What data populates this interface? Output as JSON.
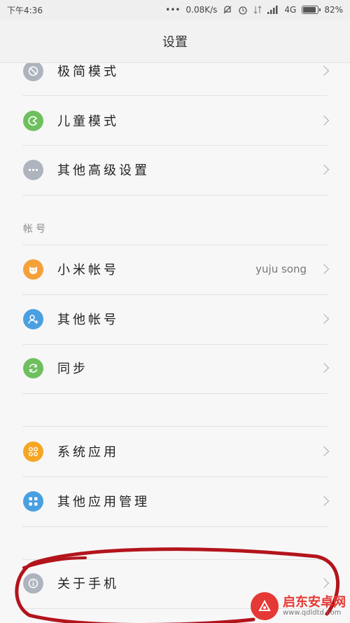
{
  "status": {
    "time": "下午4:36",
    "dots": "•••",
    "speed": "0.08K/s",
    "network": "4G",
    "battery": "82%"
  },
  "header": {
    "title": "设置"
  },
  "rows": {
    "minimal_mode": "极简模式",
    "kids_mode": "儿童模式",
    "advanced": "其他高级设置",
    "mi_account": "小米帐号",
    "mi_account_value": "yuju song",
    "other_accounts": "其他帐号",
    "sync": "同步",
    "system_apps": "系统应用",
    "other_app_mgmt": "其他应用管理",
    "about_phone": "关于手机"
  },
  "sections": {
    "account": "帐号"
  },
  "watermark": {
    "title": "启东安卓网",
    "url": "www.qdldtd.com"
  },
  "colors": {
    "gray_icon": "#aeb4bd",
    "green_icon": "#6fbf5f",
    "orange_icon": "#f5a13a",
    "blue_icon": "#4a9fe0",
    "sync_green": "#6fbf5f",
    "sysapp_orange": "#f5a623",
    "annotation_red": "#b3141c"
  }
}
